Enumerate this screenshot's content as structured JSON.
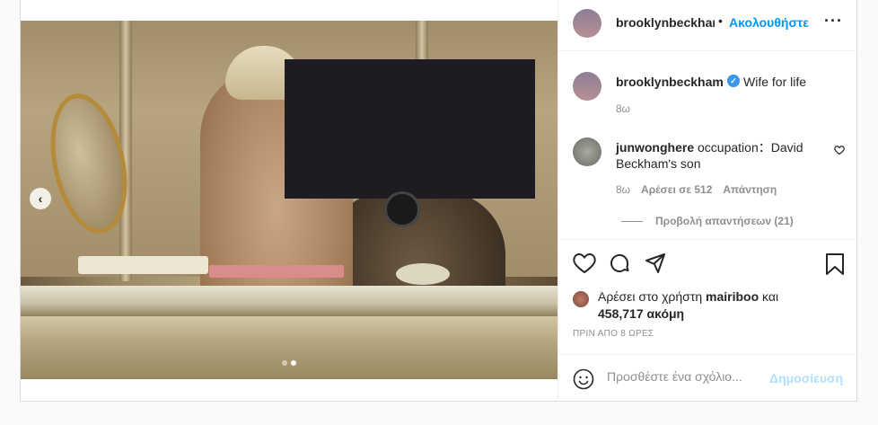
{
  "post": {
    "header": {
      "username": "brooklynbeckham",
      "separator": "•",
      "follow_label": "Ακολουθήστε",
      "more_icon": "more-icon"
    },
    "caption": {
      "username": "brooklynbeckham",
      "verified": "✓",
      "text": "Wife for life",
      "time": "8ω"
    },
    "comment": {
      "username": "junwonghere",
      "text": "occupation：David Beckham's son",
      "time": "8ω",
      "likes": "Αρέσει σε 512",
      "reply_label": "Απάντηση",
      "view_replies": "Προβολή απαντήσεων (21)"
    },
    "likes": {
      "prefix": "Αρέσει στο χρήστη",
      "liker": "mairiboo",
      "conj": "και",
      "count": "458,717 ακόμη"
    },
    "timestamp": "ΠΡΙΝ ΑΠΟ 8 ΩΡΕΣ",
    "add_comment": {
      "placeholder": "Προσθέστε ένα σχόλιο...",
      "post_label": "Δημοσίευση"
    },
    "carousel": {
      "prev_arrow": "‹",
      "current_index": 2,
      "total": 2
    },
    "colors": {
      "follow": "#0095f6",
      "post_disabled": "#b2dffc",
      "muted": "#8e8e8e"
    }
  }
}
